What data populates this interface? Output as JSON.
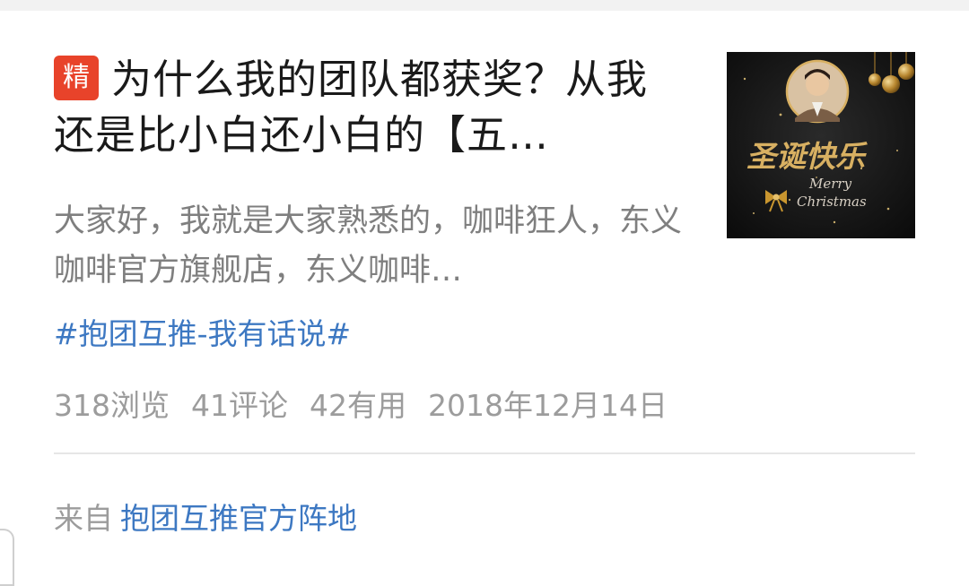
{
  "post": {
    "badge_label": "精",
    "title": "为什么我的团队都获奖？从我还是比小白还小白的【五…",
    "summary": "大家好，我就是大家熟悉的，咖啡狂人，东义咖啡官方旗舰店，东义咖啡…",
    "topic": "#抱团互推-我有话说#",
    "stats": {
      "views": "318浏览",
      "comments": "41评论",
      "useful": "42有用",
      "date": "2018年12月14日"
    },
    "source": {
      "prefix": "来自",
      "group": "抱团互推官方阵地"
    },
    "thumbnail": {
      "calligraphy": "圣诞快乐",
      "caption_line1": "Merry",
      "caption_line2": "Christmas"
    }
  },
  "colors": {
    "badge": "#e8432a",
    "link": "#3d78c2",
    "muted": "#9c9c9c",
    "title": "#1a1a1a",
    "gold": "#d8b062"
  }
}
